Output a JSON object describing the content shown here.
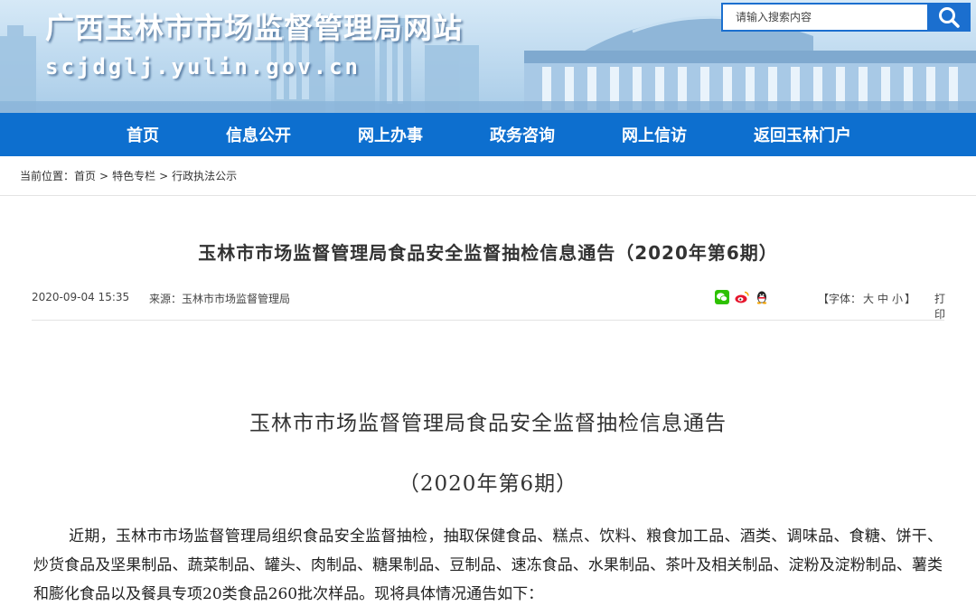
{
  "header": {
    "site_title": "广西玉林市市场监督管理局网站",
    "site_domain": "scjdglj.yulin.gov.cn",
    "search_placeholder": "请输入搜索内容",
    "search_icon": "search-icon"
  },
  "nav": {
    "items": [
      "首页",
      "信息公开",
      "网上办事",
      "政务咨询",
      "网上信访",
      "返回玉林门户"
    ]
  },
  "breadcrumb": {
    "prefix": "当前位置：",
    "items": [
      "首页",
      "特色专栏",
      "行政执法公示"
    ],
    "separator": ">"
  },
  "article": {
    "title": "玉林市市场监督管理局食品安全监督抽检信息通告（2020年第6期）",
    "date": "2020-09-04 15:35",
    "source": "来源：玉林市市场监督管理局",
    "share_icons": [
      "wechat-icon",
      "weibo-icon",
      "qq-icon"
    ],
    "font_size_label_open": "【字体：",
    "font_size_large": "大",
    "font_size_medium": "中",
    "font_size_small": "小",
    "font_size_label_close": "】",
    "print_label": "打印",
    "doc_heading": "玉林市市场监督管理局食品安全监督抽检信息通告",
    "doc_subheading": "（2020年第6期）",
    "paragraph": "近期，玉林市市场监督管理局组织食品安全监督抽检，抽取保健食品、糕点、饮料、粮食加工品、酒类、调味品、食糖、饼干、炒货食品及坚果制品、蔬菜制品、罐头、肉制品、糖果制品、豆制品、速冻食品、水果制品、茶叶及相关制品、淀粉及淀粉制品、薯类和膨化食品以及餐具专项20类食品260批次样品。现将具体情况通告如下："
  },
  "colors": {
    "nav_bg": "#0d6fcf",
    "search_border": "#1b6fcf",
    "text": "#333333"
  }
}
